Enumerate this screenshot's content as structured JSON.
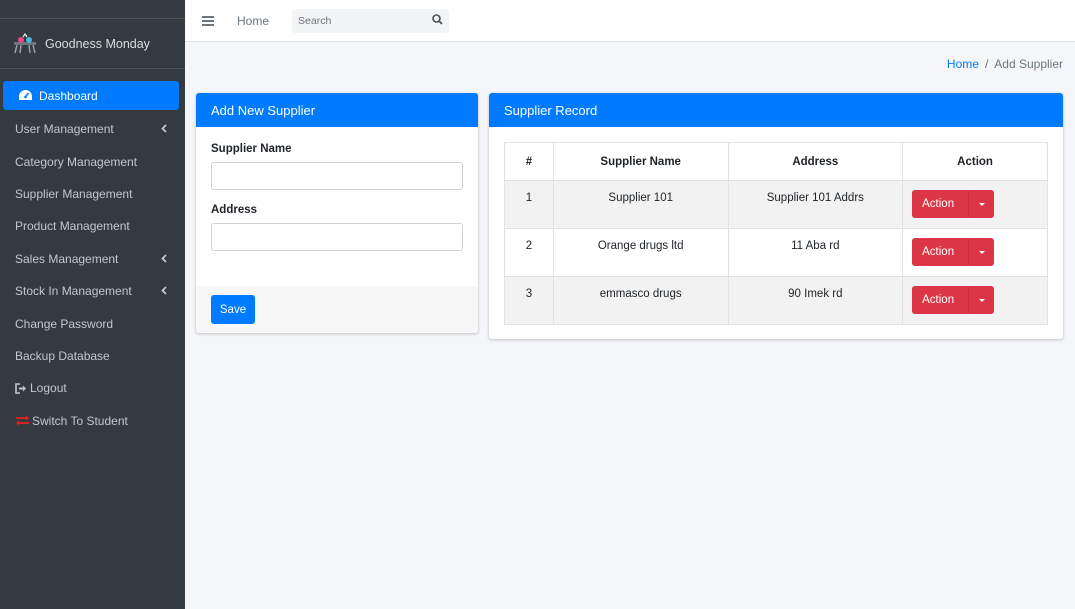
{
  "brand": {
    "name": "Goodness Monday"
  },
  "sidebar": {
    "items": [
      {
        "label": "Dashboard",
        "icon": "tachometer-icon",
        "active": true,
        "has_children": false
      },
      {
        "label": "User Management",
        "has_children": true
      },
      {
        "label": "Category Management",
        "has_children": false
      },
      {
        "label": "Supplier Management",
        "has_children": false
      },
      {
        "label": "Product Management",
        "has_children": false
      },
      {
        "label": "Sales Management",
        "has_children": true
      },
      {
        "label": "Stock In Management",
        "has_children": true
      },
      {
        "label": "Change Password",
        "has_children": false
      },
      {
        "label": "Backup Database",
        "has_children": false
      },
      {
        "label": "Logout",
        "icon": "sign-out-icon",
        "has_children": false
      },
      {
        "label": "Switch To Student",
        "icon": "exchange-icon",
        "has_children": false
      }
    ]
  },
  "topbar": {
    "home_label": "Home",
    "search_placeholder": "Search"
  },
  "breadcrumb": {
    "home": "Home",
    "separator": "/",
    "current": "Add Supplier"
  },
  "form_card": {
    "title": "Add New Supplier",
    "supplier_name_label": "Supplier Name",
    "supplier_name_value": "",
    "address_label": "Address",
    "address_value": "",
    "save_label": "Save"
  },
  "record_card": {
    "title": "Supplier Record",
    "columns": [
      "#",
      "Supplier Name",
      "Address",
      "Action"
    ],
    "rows": [
      {
        "num": "1",
        "name": "Supplier 101",
        "address": "Supplier 101 Addrs",
        "action": "Action"
      },
      {
        "num": "2",
        "name": "Orange drugs ltd",
        "address": "11 Aba rd",
        "action": "Action"
      },
      {
        "num": "3",
        "name": "emmasco drugs",
        "address": "90 Imek rd",
        "action": "Action"
      }
    ]
  },
  "colors": {
    "primary": "#007bff",
    "danger": "#dc3545",
    "sidebar_bg": "#343a40",
    "content_bg": "#f4f6f9"
  }
}
